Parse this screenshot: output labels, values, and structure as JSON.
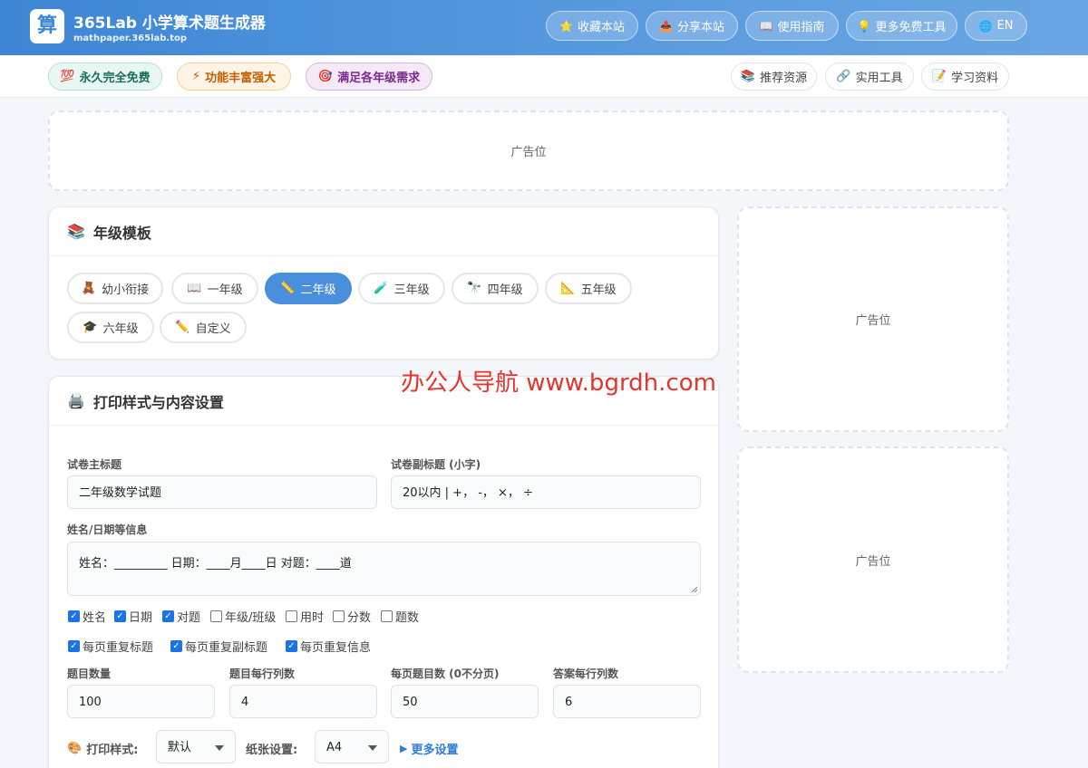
{
  "header": {
    "logo_char": "算",
    "title": "365Lab 小学算术题生成器",
    "subtitle": "mathpaper.365lab.top",
    "buttons": [
      {
        "icon": "⭐",
        "icon_name": "star-icon",
        "label": "收藏本站"
      },
      {
        "icon": "📤",
        "icon_name": "share-icon",
        "label": "分享本站"
      },
      {
        "icon": "📖",
        "icon_name": "book-icon",
        "label": "使用指南"
      },
      {
        "icon": "💡",
        "icon_name": "lightbulb-icon",
        "label": "更多免费工具"
      },
      {
        "icon": "🌐",
        "icon_name": "globe-icon",
        "label": "EN"
      }
    ]
  },
  "badges": [
    {
      "icon": "💯",
      "icon_name": "hundred-icon",
      "label": "永久完全免费"
    },
    {
      "icon": "⚡",
      "icon_name": "lightning-icon",
      "label": "功能丰富强大"
    },
    {
      "icon": "🎯",
      "icon_name": "target-icon",
      "label": "满足各年级需求"
    }
  ],
  "resource_links": [
    {
      "icon": "📚",
      "icon_name": "books-icon",
      "label": "推荐资源"
    },
    {
      "icon": "🔗",
      "icon_name": "link-icon",
      "label": "实用工具"
    },
    {
      "icon": "📝",
      "icon_name": "memo-icon",
      "label": "学习资料"
    }
  ],
  "ads": {
    "label": "广告位"
  },
  "grade_card": {
    "icon": "📚",
    "title": "年级模板",
    "grades": [
      {
        "icon": "🧸",
        "icon_name": "teddy-bear-icon",
        "label": "幼小衔接",
        "active": false
      },
      {
        "icon": "📖",
        "icon_name": "book-icon",
        "label": "一年级",
        "active": false
      },
      {
        "icon": "📏",
        "icon_name": "ruler-icon",
        "label": "二年级",
        "active": true
      },
      {
        "icon": "🧪",
        "icon_name": "test-tube-icon",
        "label": "三年级",
        "active": false
      },
      {
        "icon": "🔭",
        "icon_name": "telescope-icon",
        "label": "四年级",
        "active": false
      },
      {
        "icon": "📐",
        "icon_name": "triangle-ruler-icon",
        "label": "五年级",
        "active": false
      },
      {
        "icon": "🎓",
        "icon_name": "graduation-cap-icon",
        "label": "六年级",
        "active": false
      },
      {
        "icon": "✏️",
        "icon_name": "pencil-icon",
        "label": "自定义",
        "active": false
      }
    ]
  },
  "print_card": {
    "icon": "🖨️",
    "title": "打印样式与内容设置",
    "main_title_label": "试卷主标题",
    "main_title_value": "二年级数学试题",
    "subtitle_label": "试卷副标题 (小字)",
    "subtitle_value": "20以内 | +， -， ×， ÷",
    "info_label": "姓名/日期等信息",
    "info_value": "姓名：_________  日期：____月____日  对题：____道",
    "checkboxes_row1": [
      {
        "label": "姓名",
        "checked": true
      },
      {
        "label": "日期",
        "checked": true
      },
      {
        "label": "对题",
        "checked": true
      },
      {
        "label": "年级/班级",
        "checked": false
      },
      {
        "label": "用时",
        "checked": false
      },
      {
        "label": "分数",
        "checked": false
      },
      {
        "label": "题数",
        "checked": false
      }
    ],
    "checkboxes_row2": [
      {
        "label": "每页重复标题",
        "checked": true
      },
      {
        "label": "每页重复副标题",
        "checked": true
      },
      {
        "label": "每页重复信息",
        "checked": true
      }
    ],
    "numbers": [
      {
        "label": "题目数量",
        "value": "100"
      },
      {
        "label": "题目每行列数",
        "value": "4"
      },
      {
        "label": "每页题目数 (0不分页)",
        "value": "50"
      },
      {
        "label": "答案每行列数",
        "value": "6"
      }
    ],
    "print_style_icon": "🎨",
    "print_style_label": "打印样式:",
    "print_style_value": "默认",
    "paper_label": "纸张设置:",
    "paper_value": "A4",
    "more_settings_icon": "▶",
    "more_settings_label": "更多设置"
  },
  "watermark_text": "办公人导航 www.bgrdh.com"
}
